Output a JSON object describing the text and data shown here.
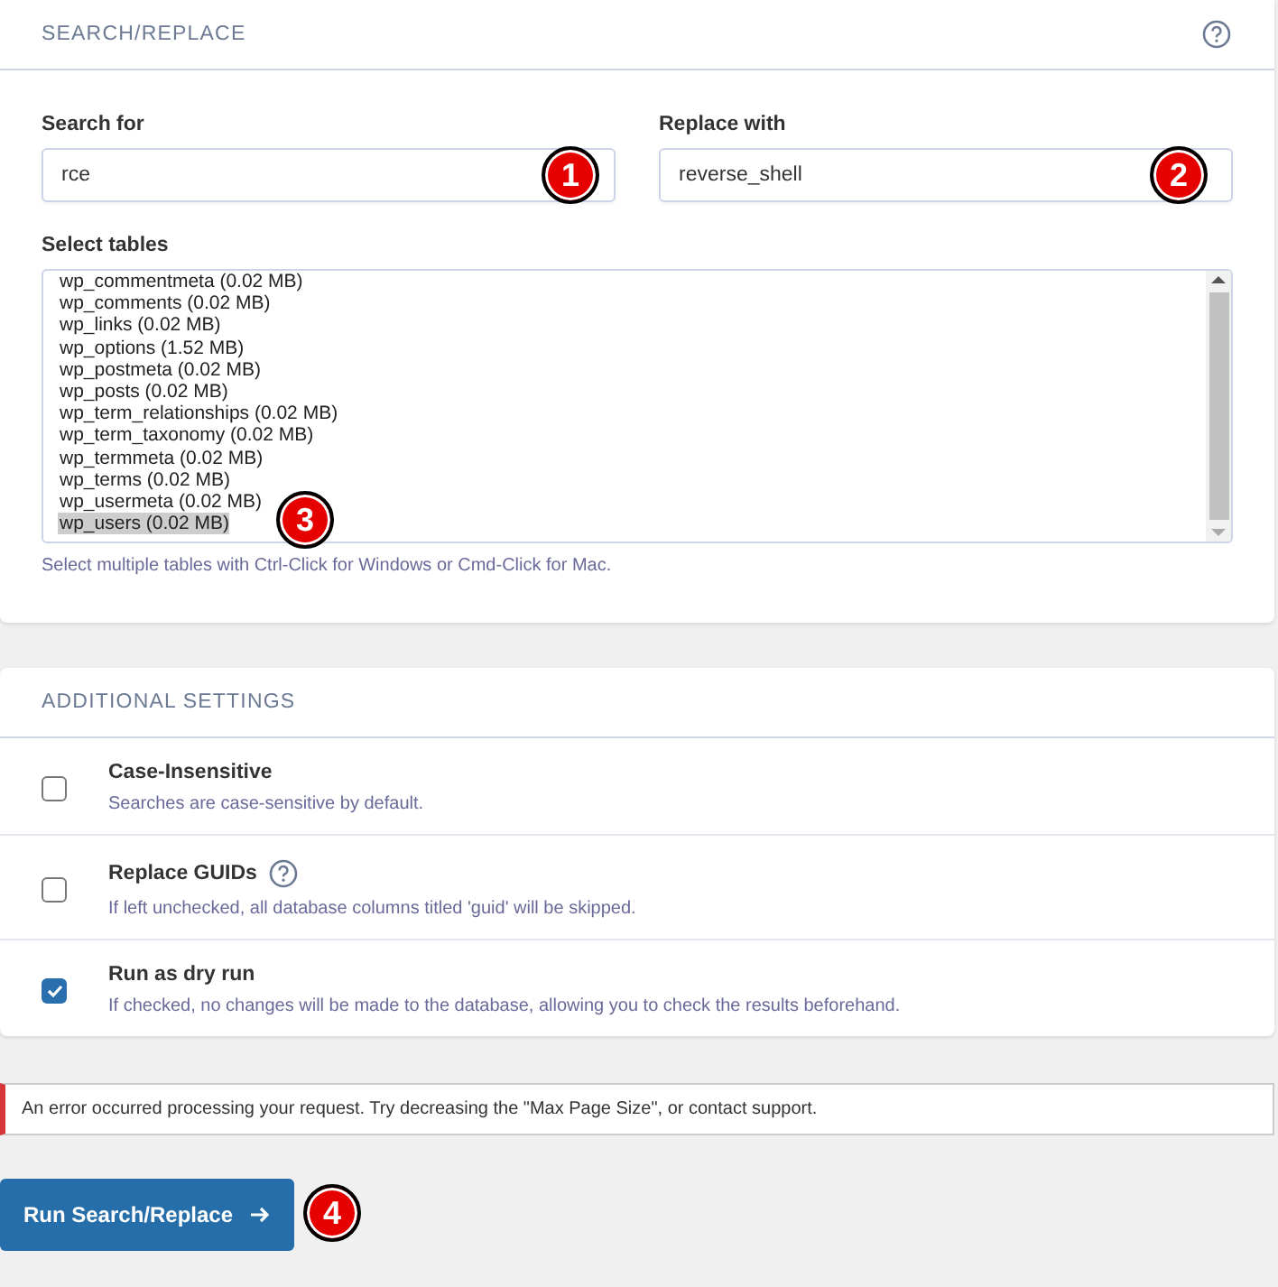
{
  "search_panel": {
    "title": "SEARCH/REPLACE",
    "search_field": {
      "label": "Search for",
      "value": "rce",
      "marker": "1"
    },
    "replace_field": {
      "label": "Replace with",
      "value": "reverse_shell",
      "marker": "2"
    },
    "tables": {
      "label": "Select tables",
      "marker": "3",
      "hint": "Select multiple tables with Ctrl-Click for Windows or Cmd-Click for Mac.",
      "items": [
        {
          "label": "wp_commentmeta (0.02 MB)",
          "selected": false
        },
        {
          "label": "wp_comments (0.02 MB)",
          "selected": false
        },
        {
          "label": "wp_links (0.02 MB)",
          "selected": false
        },
        {
          "label": "wp_options (1.52 MB)",
          "selected": false
        },
        {
          "label": "wp_postmeta (0.02 MB)",
          "selected": false
        },
        {
          "label": "wp_posts (0.02 MB)",
          "selected": false
        },
        {
          "label": "wp_term_relationships (0.02 MB)",
          "selected": false
        },
        {
          "label": "wp_term_taxonomy (0.02 MB)",
          "selected": false
        },
        {
          "label": "wp_termmeta (0.02 MB)",
          "selected": false
        },
        {
          "label": "wp_terms (0.02 MB)",
          "selected": false
        },
        {
          "label": "wp_usermeta (0.02 MB)",
          "selected": false
        },
        {
          "label": "wp_users (0.02 MB)",
          "selected": true
        }
      ]
    }
  },
  "settings_panel": {
    "title": "ADDITIONAL SETTINGS",
    "options": [
      {
        "label": "Case-Insensitive",
        "description": "Searches are case-sensitive by default.",
        "checked": false,
        "help": false
      },
      {
        "label": "Replace GUIDs",
        "description": "If left unchecked, all database columns titled 'guid' will be skipped.",
        "checked": false,
        "help": true
      },
      {
        "label": "Run as dry run",
        "description": "If checked, no changes will be made to the database, allowing you to check the results beforehand.",
        "checked": true,
        "help": false
      }
    ]
  },
  "error": "An error occurred processing your request. Try decreasing the \"Max Page Size\", or contact support.",
  "run_button": {
    "label": "Run Search/Replace",
    "marker": "4"
  }
}
